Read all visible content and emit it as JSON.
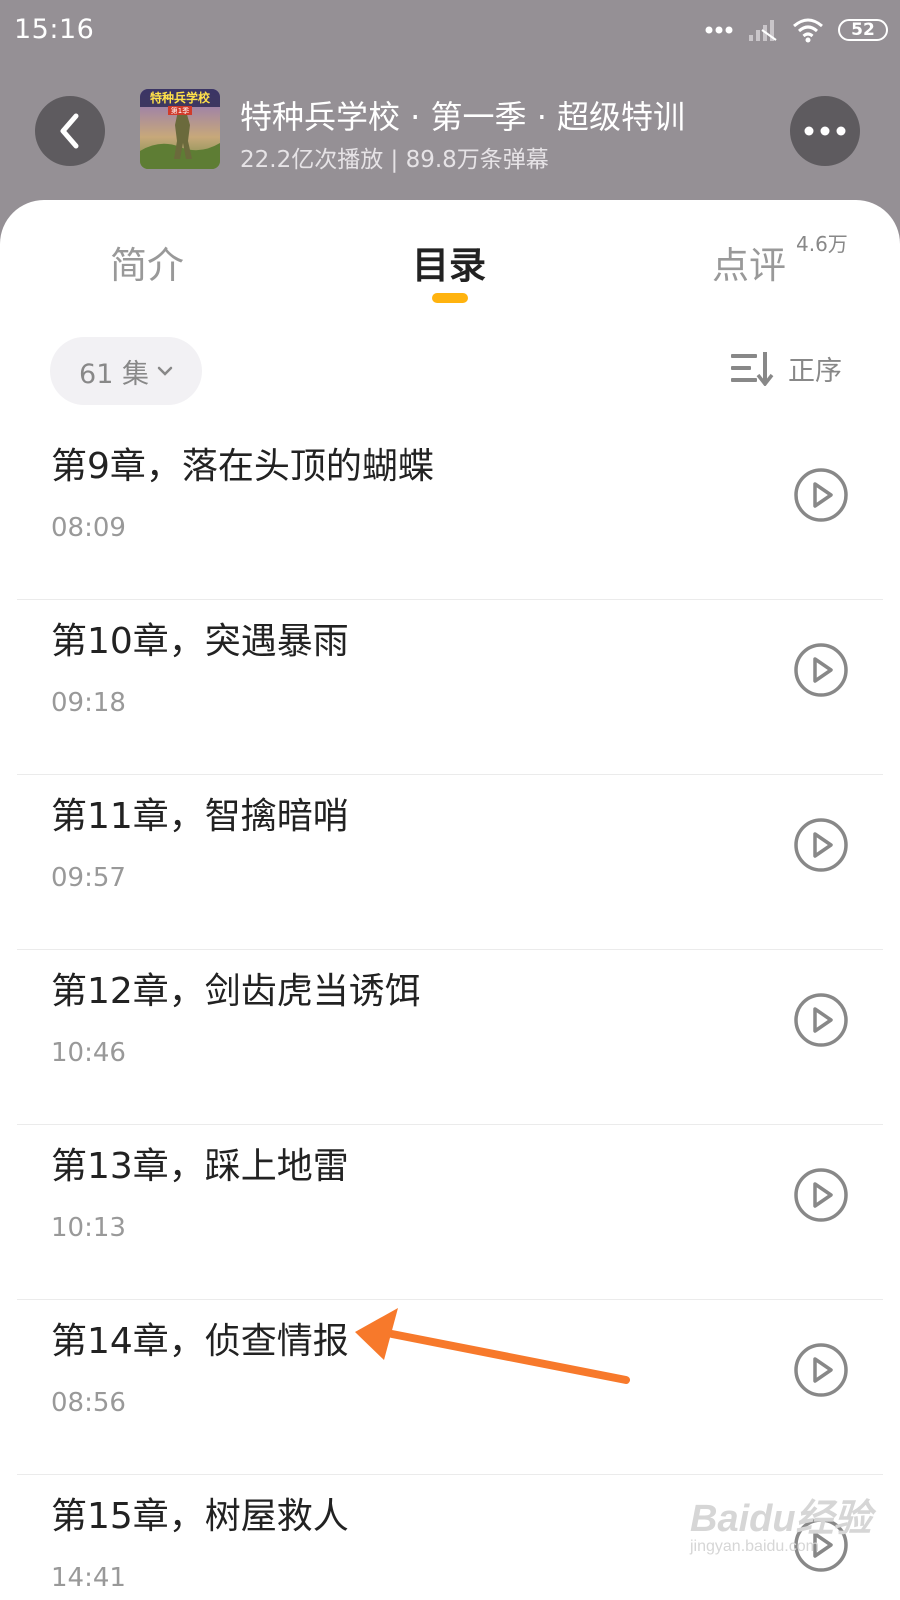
{
  "status_bar": {
    "time": "15:16",
    "battery": "52"
  },
  "header": {
    "title": "特种兵学校 · 第一季 · 超级特训",
    "subtitle": "22.2亿次播放 | 89.8万条弹幕",
    "cover_text": "特种兵学校",
    "cover_badge": "第1季"
  },
  "tabs": {
    "intro": "简介",
    "catalog": "目录",
    "review": "点评",
    "review_count": "4.6万",
    "active": "catalog"
  },
  "toolbar": {
    "episode_count": "61 集",
    "sort_label": "正序"
  },
  "chapters": [
    {
      "title": "第9章，落在头顶的蝴蝶",
      "duration": "08:09"
    },
    {
      "title": "第10章，突遇暴雨",
      "duration": "09:18"
    },
    {
      "title": "第11章，智擒暗哨",
      "duration": "09:57"
    },
    {
      "title": "第12章，剑齿虎当诱饵",
      "duration": "10:46"
    },
    {
      "title": "第13章，踩上地雷",
      "duration": "10:13"
    },
    {
      "title": "第14章，侦查情报",
      "duration": "08:56"
    },
    {
      "title": "第15章，树屋救人",
      "duration": "14:41"
    }
  ],
  "colors": {
    "accent": "#ffb30f",
    "annotation_arrow": "#f7792b",
    "header_bg": "#959095"
  },
  "watermark": {
    "top": "Baidu经验",
    "bottom": "jingyan.baidu.com"
  }
}
